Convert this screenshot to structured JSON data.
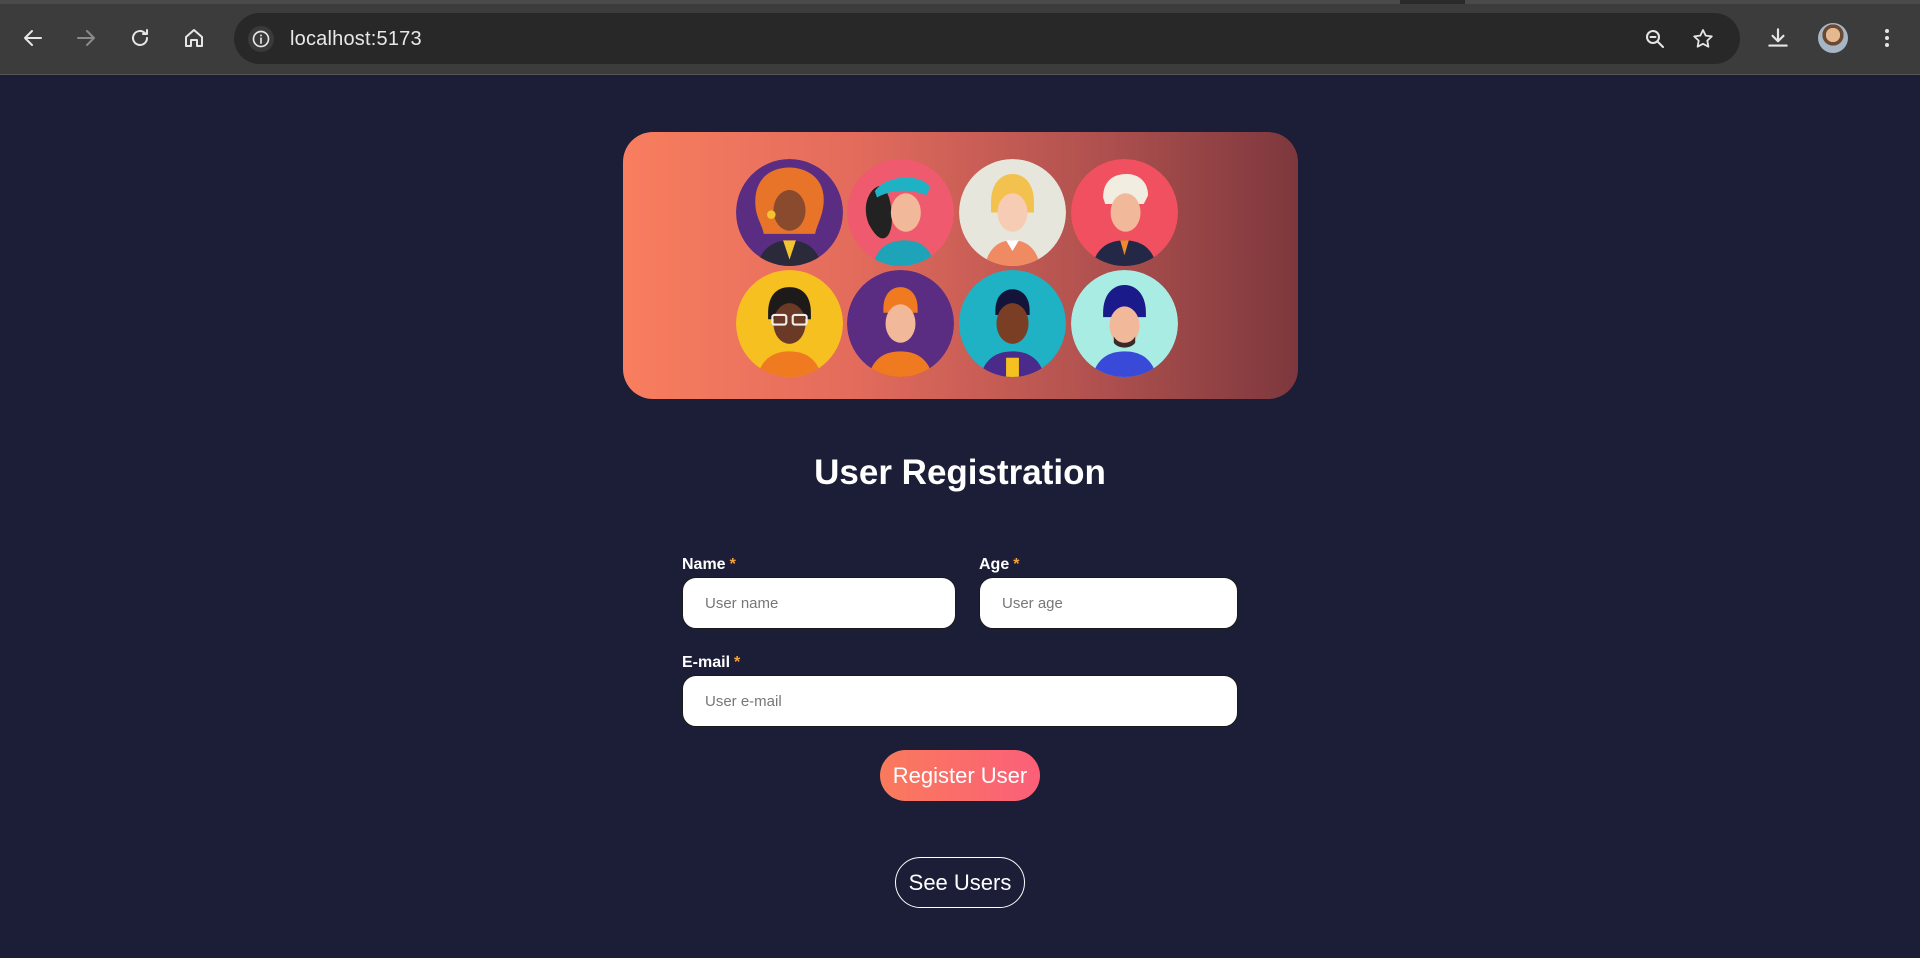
{
  "browser": {
    "url": "localhost:5173"
  },
  "page": {
    "title": "User Registration",
    "form": {
      "name_label": "Name",
      "name_placeholder": "User name",
      "age_label": "Age",
      "age_placeholder": "User age",
      "email_label": "E-mail",
      "email_placeholder": "User e-mail",
      "required_marker": "*",
      "submit_label": "Register User"
    },
    "see_users_label": "See Users"
  },
  "colors": {
    "page_background": "#1b1e36",
    "accent_required": "#f7a13b",
    "button_gradient_start": "#f97a5c",
    "button_gradient_end": "#fb5f79"
  }
}
